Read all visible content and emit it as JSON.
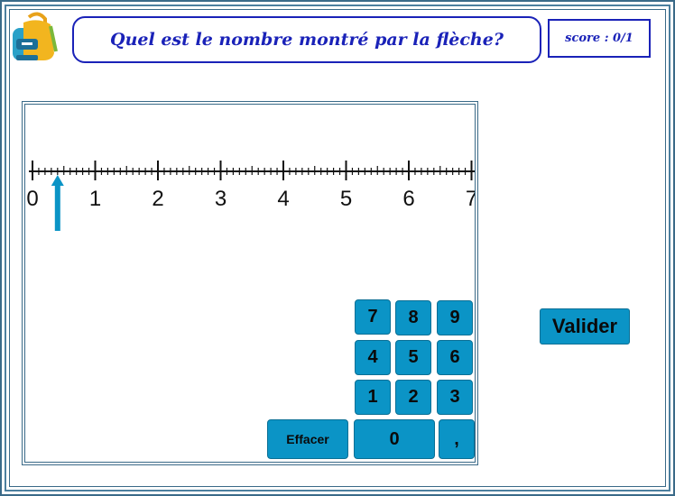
{
  "header": {
    "question": "Quel est le nombre montré par la flèche?",
    "score": "score : 0/1"
  },
  "icons": {
    "logo": "backpack-icon",
    "pointer": "arrow-up-icon"
  },
  "number_line": {
    "min": 0,
    "max": 7,
    "minor_ticks_per_unit": 10,
    "labels": [
      "0",
      "1",
      "2",
      "3",
      "4",
      "5",
      "6",
      "7"
    ],
    "arrow_value": 0.4
  },
  "keypad": {
    "rows": [
      [
        "7",
        "8",
        "9"
      ],
      [
        "4",
        "5",
        "6"
      ],
      [
        "1",
        "2",
        "3"
      ]
    ],
    "clear": "Effacer",
    "zero": "0",
    "comma": ","
  },
  "submit_label": "Valider",
  "colors": {
    "accent": "#0b94c6",
    "frame": "#3a6a88",
    "text_blue": "#1a22b8"
  }
}
